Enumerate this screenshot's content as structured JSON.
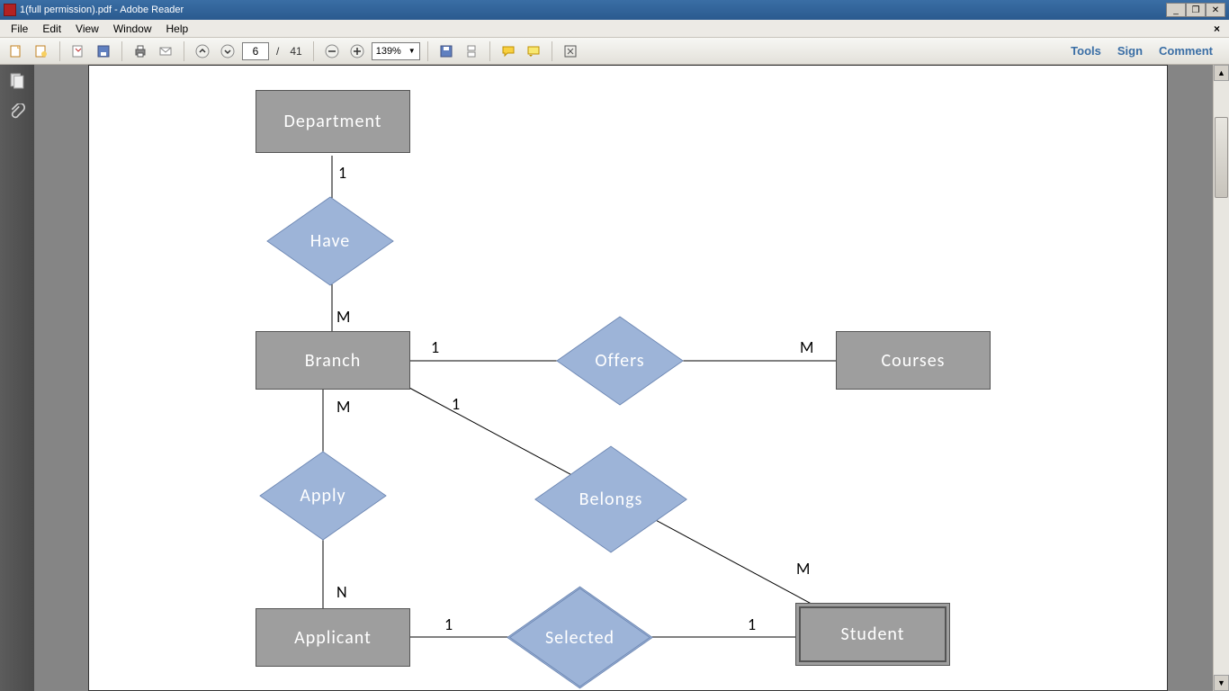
{
  "window": {
    "title": "1(full permission).pdf - Adobe Reader"
  },
  "menu": {
    "items": [
      "File",
      "Edit",
      "View",
      "Window",
      "Help"
    ]
  },
  "toolbar": {
    "page_current": "6",
    "page_sep": "/",
    "page_total": "41",
    "zoom": "139%",
    "links": {
      "tools": "Tools",
      "sign": "Sign",
      "comment": "Comment"
    }
  },
  "diagram": {
    "entities": {
      "department": "Department",
      "branch": "Branch",
      "courses": "Courses",
      "applicant": "Applicant",
      "student": "Student"
    },
    "relationships": {
      "have": "Have",
      "offers": "Offers",
      "apply": "Apply",
      "belongs": "Belongs",
      "selected": "Selected"
    },
    "cardinalities": {
      "dept_have": "1",
      "have_branch": "M",
      "branch_offers": "1",
      "offers_courses": "M",
      "branch_apply": "M",
      "apply_applicant": "N",
      "branch_belongs": "1",
      "belongs_student": "M",
      "applicant_selected": "1",
      "selected_student": "1"
    }
  }
}
